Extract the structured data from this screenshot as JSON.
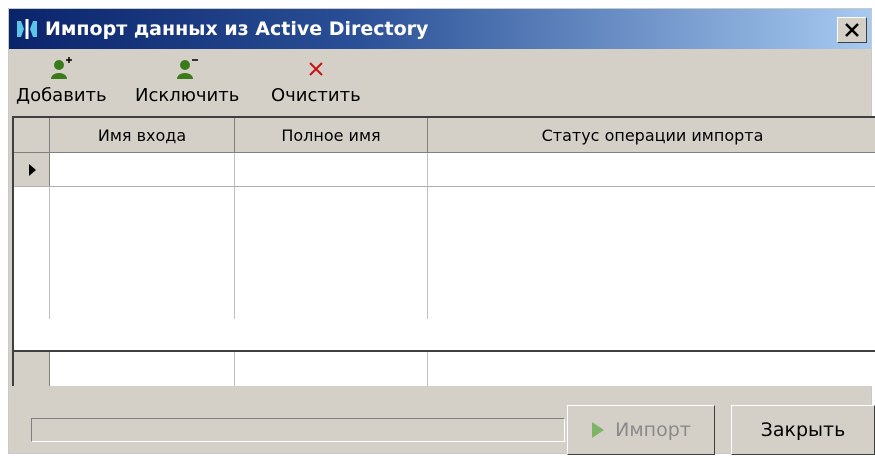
{
  "window": {
    "title": "Импорт данных из Active Directory"
  },
  "toolbar": {
    "add_label": "Добавить",
    "remove_label": "Исключить",
    "clear_label": "Очистить"
  },
  "grid": {
    "columns": [
      "Имя входа",
      "Полное имя",
      "Статус операции импорта"
    ],
    "rows": [
      [
        "",
        "",
        ""
      ]
    ]
  },
  "footer": {
    "progress": 0,
    "import_label": "Импорт",
    "close_label": "Закрыть"
  },
  "colors": {
    "title_gradient_start": "#0a246a",
    "title_gradient_end": "#a6caf0",
    "window_face": "#d4d0c8",
    "clear_icon": "#cc1111",
    "user_icon": "#3a7a1a"
  },
  "icons": {
    "app": "app-logo-icon",
    "add": "user-add-icon",
    "remove": "user-remove-icon",
    "clear": "clear-x-icon",
    "close": "close-icon",
    "import": "play-arrow-icon",
    "row_indicator": "row-pointer-icon"
  }
}
